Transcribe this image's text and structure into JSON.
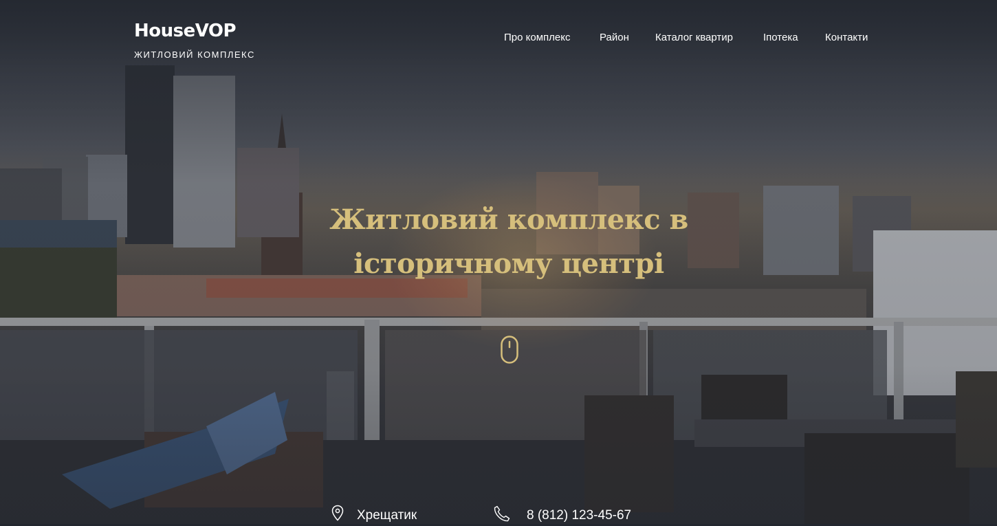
{
  "brand": {
    "name": "HouseVOP",
    "tagline": "ЖИТЛОВИЙ КОМПЛЕКС"
  },
  "nav": {
    "items": [
      {
        "label": "Про комплекс"
      },
      {
        "label": "Район"
      },
      {
        "label": "Каталог квартир"
      },
      {
        "label": "Іпотека"
      },
      {
        "label": "Контакти"
      }
    ]
  },
  "hero": {
    "headline_line1": "Житловий комплекс в",
    "headline_line2": "історичному центрі",
    "scroll_icon": "mouse-scroll-icon"
  },
  "contacts": {
    "address": "Хрещатик",
    "address_icon": "location-pin-icon",
    "phone": "8 (812) 123-45-67",
    "phone_icon": "phone-icon"
  },
  "colors": {
    "accent_gold": "#d6bf7c",
    "text_white": "#ffffff",
    "overlay_dark": "#23272f"
  }
}
